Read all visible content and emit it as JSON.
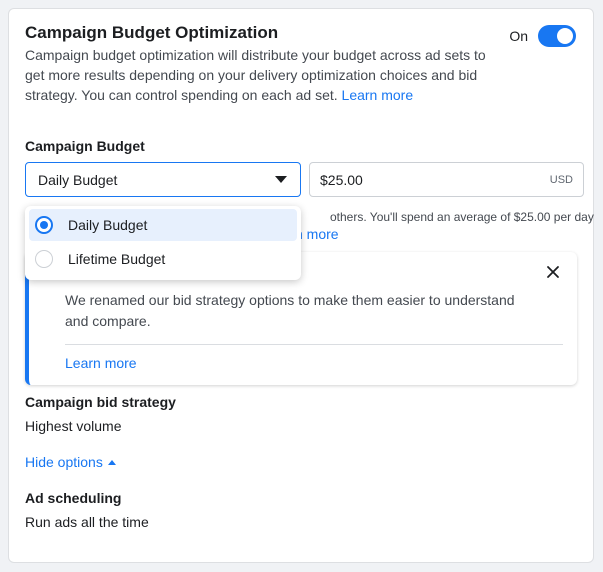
{
  "header": {
    "title": "Campaign Budget Optimization",
    "description": "Campaign budget optimization will distribute your budget across ad sets to get more results depending on your delivery optimization choices and bid strategy. You can control spending on each ad set.",
    "learn_more": "Learn more",
    "toggle_label": "On",
    "toggle_state": "on"
  },
  "budget": {
    "label": "Campaign Budget",
    "select_value": "Daily Budget",
    "amount": "$25.00",
    "currency": "USD",
    "hint_line1": "others. You'll spend an average of $25.00 per day",
    "hint_line2": "n more",
    "options": [
      {
        "label": "Daily Budget",
        "selected": true
      },
      {
        "label": "Lifetime Budget",
        "selected": false
      }
    ]
  },
  "info_box": {
    "title": "",
    "text": "We renamed our bid strategy options to make them easier to understand and compare.",
    "learn_more": "Learn more"
  },
  "bid_strategy": {
    "label": "Campaign bid strategy",
    "value": "Highest volume"
  },
  "hide_options": "Hide options",
  "ad_scheduling": {
    "label": "Ad scheduling",
    "value": "Run ads all the time"
  },
  "colors": {
    "accent": "#1877f2",
    "selected_bg": "#e7f0fd"
  }
}
